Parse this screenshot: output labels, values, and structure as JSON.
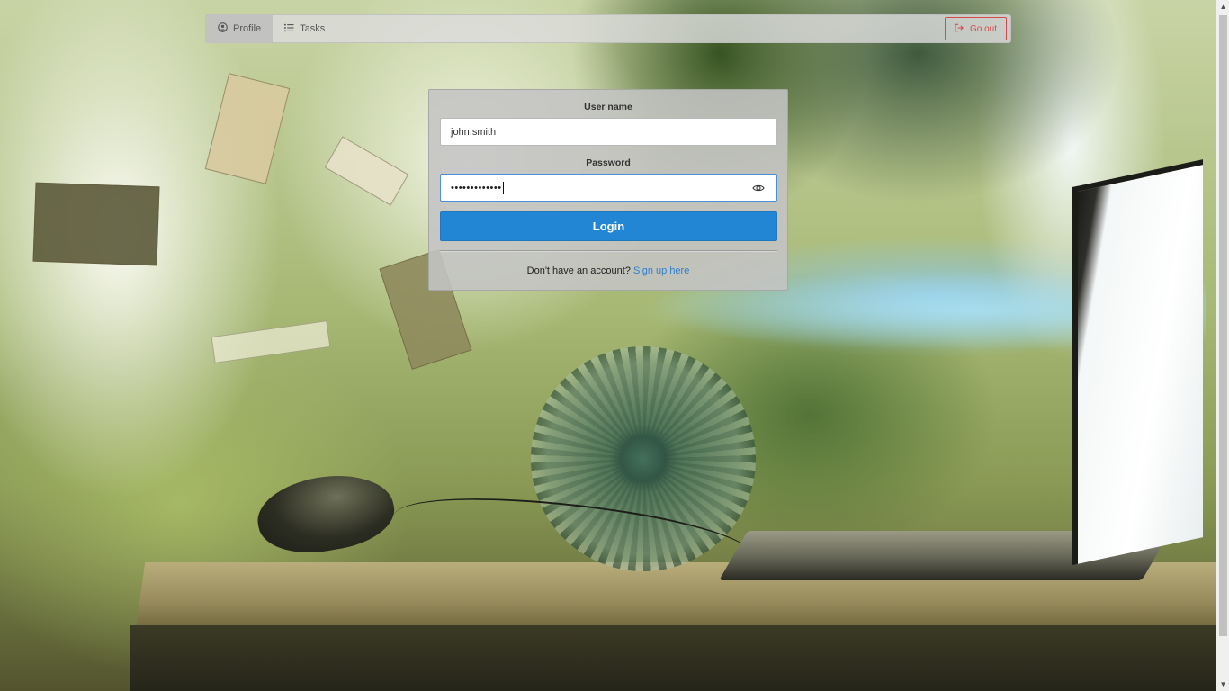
{
  "nav": {
    "items": [
      {
        "label": "Profile",
        "icon": "user-circle-icon",
        "active": true
      },
      {
        "label": "Tasks",
        "icon": "list-icon",
        "active": false
      }
    ],
    "go_out_label": "Go out",
    "go_out_icon": "sign-out-icon"
  },
  "login": {
    "username_label": "User name",
    "username_value": "john.smith",
    "password_label": "Password",
    "password_mask": "•••••••••••••",
    "show_password_icon": "eye-icon",
    "login_button": "Login",
    "signup_prompt": "Don't have an account?",
    "signup_link": "Sign up here"
  },
  "colors": {
    "primary": "#2286d4",
    "link": "#2b7fcf",
    "danger": "#d84a4a"
  }
}
